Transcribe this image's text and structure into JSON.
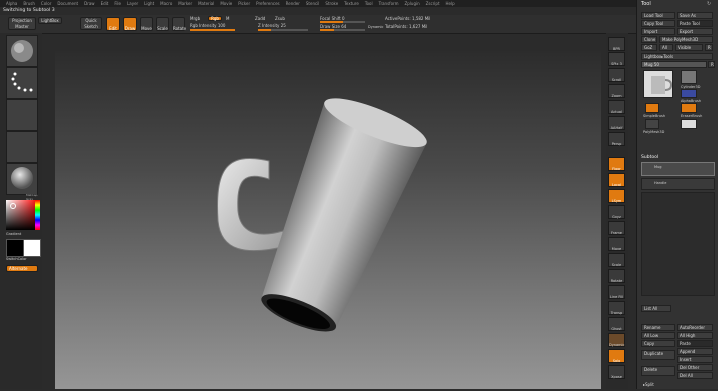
{
  "menu": [
    "Alpha",
    "Brush",
    "Color",
    "Document",
    "Draw",
    "Edit",
    "File",
    "Layer",
    "Light",
    "Macro",
    "Marker",
    "Material",
    "Movie",
    "Picker",
    "Preferences",
    "Render",
    "Stencil",
    "Stroke",
    "Texture",
    "Tool",
    "Transform",
    "Zplugin",
    "Zscript",
    "Help"
  ],
  "status": "Switching to Subtool 3",
  "shelf": {
    "projection_master": "Projection Master",
    "lightbox": "LightBox",
    "quick_sketch": "Quick Sketch",
    "edit": "Edit",
    "draw": "Draw",
    "move": "Move",
    "scale": "Scale",
    "rotate": "Rotate",
    "mrgb": "Mrgb",
    "rgb": "Rgb",
    "m": "M",
    "rgb_intensity_label": "Rgb Intensity",
    "rgb_intensity_value": "100",
    "zadd": "Zadd",
    "zsub": "Zsub",
    "z_intensity_label": "Z Intensity",
    "z_intensity_value": "25",
    "focal_shift_label": "Focal Shift",
    "focal_shift_value": "0",
    "draw_size_label": "Draw Size",
    "draw_size_value": "64",
    "dynamic": "Dynamic",
    "active_points": "ActivePoints: 1,582 Mil",
    "total_points": "TotalPoints: 1,627 Mil"
  },
  "levels": {
    "rgb_intensity": 1.0,
    "z_intensity": 0.25,
    "draw_size": 0.3
  },
  "left": {
    "gradient": "Gradient",
    "switch_color": "SwitchColor",
    "alternate": "Alternate",
    "material_label": "MatCap Gray"
  },
  "right_toolbar": [
    "BPR",
    "SPix 3",
    "Scroll",
    "Zoom",
    "Actual",
    "AAHalf",
    "Persp",
    "Floor",
    "Local",
    "LSym",
    "Gxyz",
    "Frame",
    "Move",
    "Scale",
    "Rotate",
    "Line Fill PolyF",
    "Transp",
    "Ghost",
    "Dynamic",
    "Solo",
    "Xpose"
  ],
  "tool_panel": {
    "title": "Tool",
    "load_tool": "Load Tool",
    "save_as": "Save As",
    "copy_tool": "Copy Tool",
    "paste_tool": "Paste Tool",
    "import": "Import",
    "export": "Export",
    "clone": "Clone",
    "make_polymesh": "Make PolyMesh3D",
    "goz": "GoZ",
    "all": "All",
    "visible": "Visible",
    "r": "R",
    "lightbox_tools": "Lightbox▸Tools",
    "current_tool": "Mug",
    "tool_value": "50",
    "r2": "R",
    "tools": [
      "Cylinder3D",
      "AlphaBrush",
      "SimpleBrush",
      "EraserBrush",
      "PolyMesh3D"
    ],
    "subtool_header": "Subtool",
    "subtools": [
      "Mug",
      "Handle"
    ],
    "list_all": "List All",
    "rename": "Rename",
    "auto_reorder": "AutoReorder",
    "all_low": "All Low",
    "all_high": "All High",
    "copy": "Copy",
    "paste": "Paste",
    "duplicate": "Duplicate",
    "append": "Append",
    "insert": "Insert",
    "delete": "Delete",
    "del_other": "Del Other",
    "del_all": "Del All",
    "split": "▸Split"
  },
  "colors": {
    "accent": "#e07a10",
    "panel": "#323232",
    "background": "#2b2b2b"
  }
}
